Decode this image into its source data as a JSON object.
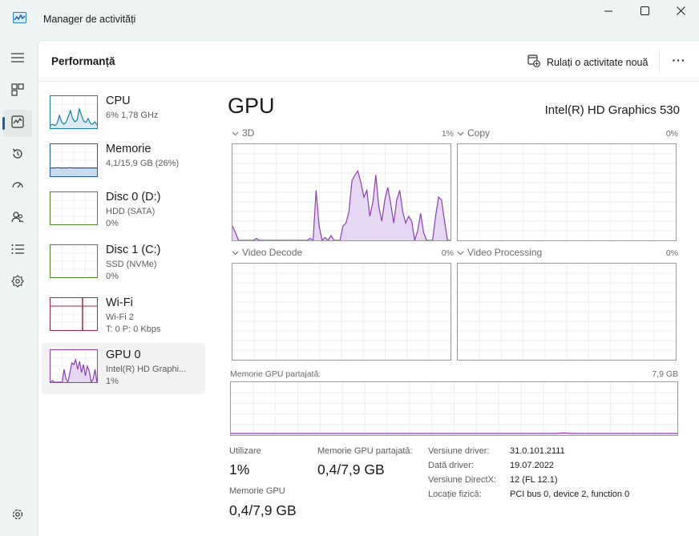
{
  "window": {
    "title": "Manager de activități",
    "controls": [
      "minimize-icon",
      "maximize-icon",
      "close-icon"
    ]
  },
  "rail": {
    "items": [
      {
        "icon": "hamburger-menu-icon"
      },
      {
        "icon": "processes-icon"
      },
      {
        "icon": "performance-icon",
        "active": true
      },
      {
        "icon": "app-history-icon"
      },
      {
        "icon": "startup-apps-icon"
      },
      {
        "icon": "users-icon"
      },
      {
        "icon": "details-icon"
      },
      {
        "icon": "services-icon"
      },
      {
        "icon": "settings-icon"
      }
    ]
  },
  "header": {
    "title": "Performanță",
    "run_task": "Rulați o activitate nouă",
    "more": "···"
  },
  "devices": [
    {
      "name": "CPU",
      "sub1": "6%  1,78 GHz",
      "sub2": "",
      "color": "#1a7fa0"
    },
    {
      "name": "Memorie",
      "sub1": "4,1/15,9 GB (26%)",
      "sub2": "",
      "color": "#1f5aa6"
    },
    {
      "name": "Disc 0 (D:)",
      "sub1": "HDD (SATA)",
      "sub2": "0%",
      "color": "#4f8a2a"
    },
    {
      "name": "Disc 1 (C:)",
      "sub1": "SSD (NVMe)",
      "sub2": "0%",
      "color": "#4f8a2a"
    },
    {
      "name": "Wi-Fi",
      "sub1": "Wi-Fi 2",
      "sub2": "T: 0  P: 0 Kbps",
      "color": "#a0284c"
    },
    {
      "name": "GPU 0",
      "sub1": "Intel(R) HD Graphi...",
      "sub2": "1%",
      "color": "#8a3fb8",
      "selected": true
    }
  ],
  "gpu": {
    "title": "GPU",
    "model": "Intel(R) HD Graphics 530",
    "engines": [
      {
        "label": "3D",
        "pct": "1%"
      },
      {
        "label": "Copy",
        "pct": "0%"
      },
      {
        "label": "Video Decode",
        "pct": "0%"
      },
      {
        "label": "Video Processing",
        "pct": "0%"
      }
    ],
    "shared_memory": {
      "label": "Memorie GPU partajată:",
      "max": "7,9 GB"
    },
    "stats": {
      "utilization_label": "Utilizare",
      "utilization_value": "1%",
      "shared_label": "Memorie GPU partajată:",
      "shared_value": "0,4/7,9 GB",
      "gpu_mem_label": "Memorie GPU",
      "gpu_mem_value": "0,4/7,9 GB"
    },
    "info": [
      {
        "k": "Versiune driver:",
        "v": "31.0.101.2111"
      },
      {
        "k": "Dată driver:",
        "v": "19.07.2022"
      },
      {
        "k": "Versiune DirectX:",
        "v": "12 (FL 12.1)"
      },
      {
        "k": "Locație fizică:",
        "v": "PCI bus 0, device 2, function 0"
      }
    ],
    "series_3d": [
      15,
      8,
      0,
      0,
      0,
      0,
      0,
      0,
      2,
      0,
      0,
      0,
      0,
      0,
      0,
      0,
      0,
      0,
      0,
      0,
      0,
      0,
      0,
      0,
      0,
      0,
      2,
      0,
      52,
      15,
      0,
      3,
      0,
      5,
      0,
      0,
      0,
      15,
      18,
      30,
      62,
      68,
      72,
      60,
      45,
      52,
      25,
      40,
      68,
      35,
      20,
      42,
      55,
      38,
      18,
      42,
      52,
      30,
      18,
      25,
      20,
      0,
      10,
      28,
      8,
      0,
      0,
      0,
      25,
      45,
      42,
      20,
      0,
      0
    ],
    "colors": {
      "gpu_line": "#8a3fb8",
      "gpu_fill": "#e6d7f2"
    }
  }
}
